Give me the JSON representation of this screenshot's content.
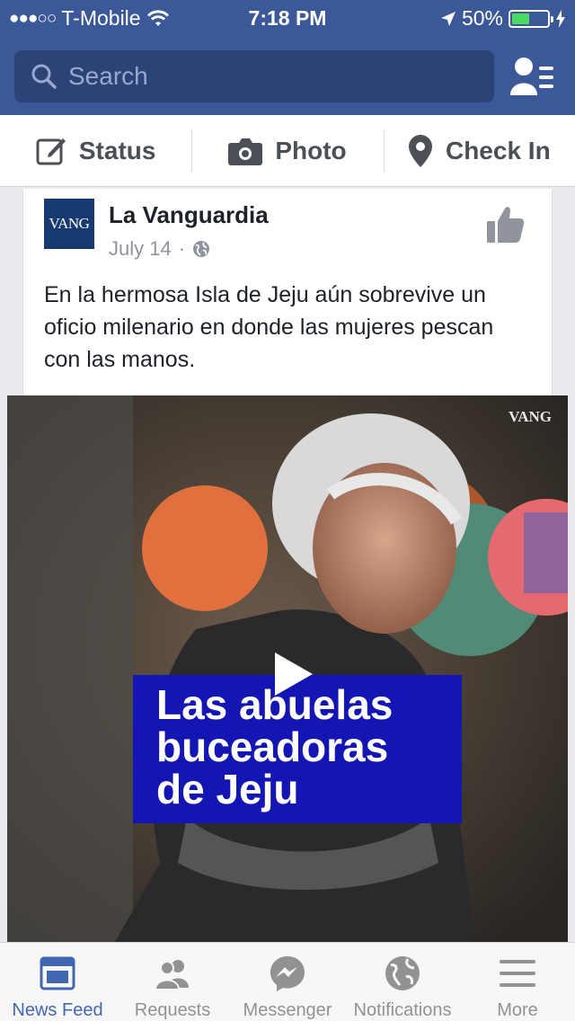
{
  "status_bar": {
    "carrier": "T-Mobile",
    "time": "7:18 PM",
    "battery": "50%",
    "battery_level": 0.5
  },
  "nav": {
    "search_placeholder": "Search"
  },
  "composer": {
    "status_label": "Status",
    "photo_label": "Photo",
    "checkin_label": "Check In"
  },
  "post": {
    "page_logo_text": "VANG",
    "page_name": "La Vanguardia",
    "date": "July 14",
    "separator": "·",
    "text": "En la hermosa Isla de Jeju aún sobrevive un oficio milenario en donde las mujeres pescan con las manos.",
    "video": {
      "watermark": "VANG",
      "title_line1": "Las abuelas",
      "title_line2": "buceadoras",
      "title_line3": "de Jeju"
    }
  },
  "tabs": [
    {
      "label": "News Feed",
      "icon": "news-feed-icon",
      "active": true
    },
    {
      "label": "Requests",
      "icon": "friend-requests-icon",
      "active": false
    },
    {
      "label": "Messenger",
      "icon": "messenger-icon",
      "active": false
    },
    {
      "label": "Notifications",
      "icon": "globe-icon",
      "active": false
    },
    {
      "label": "More",
      "icon": "menu-icon",
      "active": false
    }
  ],
  "colors": {
    "brand": "#3b5998",
    "active_tab": "#4267b2",
    "banner": "#1416b4"
  }
}
